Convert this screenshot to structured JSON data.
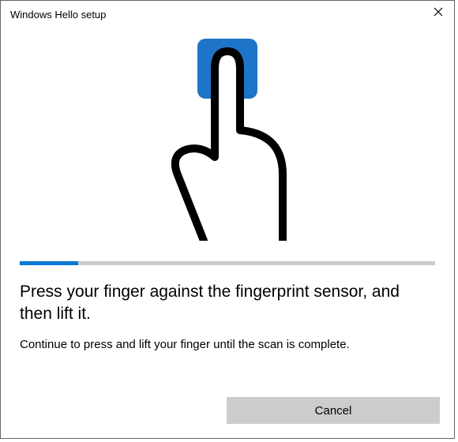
{
  "window": {
    "title": "Windows Hello setup"
  },
  "progress": {
    "percent": 14
  },
  "heading": "Press your finger against the fingerprint sensor, and then lift it.",
  "subtext": "Continue to press and lift your finger until the scan is complete.",
  "buttons": {
    "cancel": "Cancel"
  },
  "colors": {
    "accent": "#0078d4",
    "progress_track": "#cccccc",
    "button_bg": "#cccccc"
  }
}
